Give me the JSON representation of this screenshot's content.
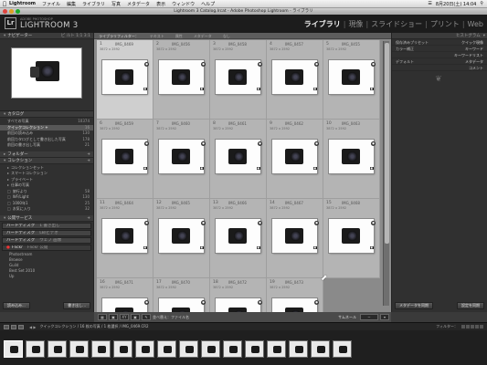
{
  "menubar": {
    "app": "Lightroom",
    "items": [
      "ファイル",
      "編集",
      "ライブラリ",
      "写真",
      "メタデータ",
      "表示",
      "ウィンドウ",
      "ヘルプ"
    ],
    "clock": "8月20日(土) 14:04"
  },
  "window": {
    "title": "Lightroom 3 Catalog.lrcat - Adobe Photoshop Lightroom - ライブラリ"
  },
  "identity": {
    "logo": "Lr",
    "sub": "ADOBE PHOTOSHOP",
    "name": "LIGHTROOM 3"
  },
  "modules": [
    {
      "label": "ライブラリ",
      "active": true
    },
    {
      "label": "現像",
      "active": false
    },
    {
      "label": "スライドショー",
      "active": false
    },
    {
      "label": "プリント",
      "active": false
    },
    {
      "label": "Web",
      "active": false
    }
  ],
  "left": {
    "navigator": {
      "title": "ナビゲーター",
      "zoom": "ビ ルト 1:1 3:1"
    },
    "catalog": {
      "title": "カタログ",
      "items": [
        {
          "label": "すべての写真",
          "count": "10374",
          "selected": false
        },
        {
          "label": "クイックコレクション +",
          "count": "16",
          "selected": true
        },
        {
          "label": "前回の読み込み",
          "count": "130",
          "selected": false
        },
        {
          "label": "前回カタログとして書き出した写真",
          "count": "178",
          "selected": false
        },
        {
          "label": "前回の書き出し写真",
          "count": "21",
          "selected": false
        }
      ]
    },
    "folders": {
      "title": "フォルダー"
    },
    "collections": {
      "title": "コレクション",
      "items": [
        {
          "label": "コレクションセット",
          "count": ""
        },
        {
          "label": "スマートコレクション",
          "count": ""
        },
        {
          "label": "プライベート",
          "count": ""
        },
        {
          "label": "仕事の写真",
          "count": ""
        },
        {
          "label": "旅行より",
          "count": "58"
        },
        {
          "label": "WF/Light",
          "count": "130"
        },
        {
          "label": "1000年1",
          "count": "25"
        },
        {
          "label": "お気に入り",
          "count": "32"
        }
      ]
    },
    "publish": {
      "title": "公開サービス",
      "drives": [
        {
          "label": "ハードディスク",
          "sub": "1 書き出し"
        },
        {
          "label": "ハードディスク",
          "sub": "LB/ビデオ"
        },
        {
          "label": "ハードディスク",
          "sub": "ウェブ 画像"
        }
      ],
      "flickr": "Flickr",
      "flickr_sub": "Flickr 公開",
      "flickr_items": [
        "Photostream",
        "Browse",
        "Guild",
        "Best Set 2010",
        "Up"
      ]
    },
    "buttons": {
      "import": "読み込み...",
      "export": "書き出し..."
    }
  },
  "right": {
    "histogram": "ヒストグラム",
    "rows": [
      {
        "left": "保存済みプリセット",
        "right": "クイック現像"
      },
      {
        "left": "カラー補正",
        "right": "キーワード"
      },
      {
        "left": "",
        "right": "キーワードリスト"
      },
      {
        "left": "デフォルト",
        "right": "メタデータ"
      },
      {
        "left": "",
        "right": "コメント"
      }
    ],
    "buttons": {
      "sync_meta": "メタデータを同期",
      "sync_settings": "設定を同期"
    }
  },
  "grid": {
    "filter": [
      "ライブラリフィルター：",
      "テキスト",
      "属性",
      "メタデータ",
      "なし"
    ],
    "cells": [
      {
        "num": "1",
        "fname": "IMG_0469",
        "dims": "3872 x 2592",
        "selected": true
      },
      {
        "num": "2",
        "fname": "IMG_0456",
        "dims": "3872 x 2592",
        "selected": false
      },
      {
        "num": "3",
        "fname": "IMG_0458",
        "dims": "3872 x 2592",
        "selected": false
      },
      {
        "num": "4",
        "fname": "IMG_0457",
        "dims": "3872 x 2592",
        "selected": false
      },
      {
        "num": "5",
        "fname": "IMG_0455",
        "dims": "3872 x 2592",
        "selected": false
      },
      {
        "num": "6",
        "fname": "IMG_0459",
        "dims": "3872 x 2592",
        "selected": false
      },
      {
        "num": "7",
        "fname": "IMG_0460",
        "dims": "3872 x 2592",
        "selected": false
      },
      {
        "num": "8",
        "fname": "IMG_0461",
        "dims": "3872 x 2592",
        "selected": false
      },
      {
        "num": "9",
        "fname": "IMG_0462",
        "dims": "3872 x 2592",
        "selected": false
      },
      {
        "num": "10",
        "fname": "IMG_0463",
        "dims": "3872 x 2592",
        "selected": false
      },
      {
        "num": "11",
        "fname": "IMG_0464",
        "dims": "3872 x 2592",
        "selected": false
      },
      {
        "num": "12",
        "fname": "IMG_0465",
        "dims": "3872 x 2592",
        "selected": false
      },
      {
        "num": "13",
        "fname": "IMG_0466",
        "dims": "3872 x 2592",
        "selected": false
      },
      {
        "num": "14",
        "fname": "IMG_0467",
        "dims": "3872 x 2592",
        "selected": false
      },
      {
        "num": "15",
        "fname": "IMG_0468",
        "dims": "3872 x 2592",
        "selected": false
      },
      {
        "num": "16",
        "fname": "IMG_0471",
        "dims": "3872 x 2592",
        "selected": false
      },
      {
        "num": "17",
        "fname": "IMG_0470",
        "dims": "3872 x 2592",
        "selected": false
      },
      {
        "num": "18",
        "fname": "IMG_0472",
        "dims": "3872 x 2592",
        "selected": false
      },
      {
        "num": "19",
        "fname": "IMG_0473",
        "dims": "3872 x 2592",
        "selected": false
      }
    ],
    "thumbnails_label": "サムネール",
    "sort_label": "並べ替え：ファイル名"
  },
  "filmstrip": {
    "path": "クイックコレクション / 16 枚の写真 / 1 枚選択 / IMG_0469.CR2",
    "filter_label": "フィルター：",
    "count": 16
  }
}
